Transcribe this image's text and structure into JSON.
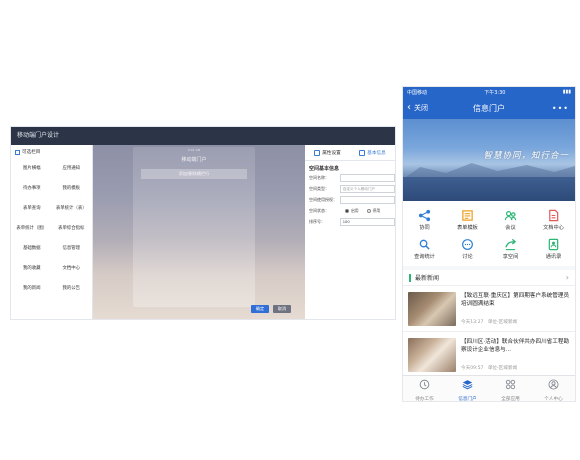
{
  "designer": {
    "title": "移动端门户设计",
    "left_panel": {
      "heading": "可选栏目",
      "items": [
        "图片横幅",
        "应用通知",
        "待办事项",
        "我的模板",
        "表单查询",
        "表单统计（表）",
        "表单统计（图）",
        "表单综合指标",
        "基础数据",
        "信息管理",
        "我的收藏",
        "文档中心",
        "我的新闻",
        "我的公告"
      ]
    },
    "canvas": {
      "phone_status": "9:41 AM",
      "phone_title": "移动端门户",
      "add_row_label": "添加/删除横栏行",
      "ok_label": "确定",
      "cancel_label": "取消"
    },
    "right_panel": {
      "tab_properties": "属性设置",
      "tab_basic": "基本信息",
      "section_title": "空间基本信息",
      "form": {
        "name_label": "空间名称：",
        "type_label": "空间类型：",
        "type_value": "自定义个人移动门户",
        "desc_label": "空间使用授权：",
        "status_label": "空间状态：",
        "status_enabled": "启用",
        "status_disabled": "停用",
        "sort_label": "排序号：",
        "sort_value": "100"
      }
    }
  },
  "phone": {
    "status": {
      "carrier": "中国移动",
      "time": "下午3:30"
    },
    "navbar": {
      "back_label": "关闭",
      "title": "信息门户"
    },
    "banner_slogan": "智慧协同，知行合一",
    "apps": [
      {
        "label": "协同",
        "icon": "share-icon",
        "color": "#2f7fd8"
      },
      {
        "label": "表单模板",
        "icon": "form-template-icon",
        "color": "#f0a32c"
      },
      {
        "label": "会议",
        "icon": "meeting-icon",
        "color": "#2bb673"
      },
      {
        "label": "文档中心",
        "icon": "document-icon",
        "color": "#e05a5a"
      },
      {
        "label": "查询统计",
        "icon": "query-icon",
        "color": "#2f7fd8"
      },
      {
        "label": "讨论",
        "icon": "discussion-icon",
        "color": "#2f7fd8"
      },
      {
        "label": "享空间",
        "icon": "share-space-icon",
        "color": "#2bb673"
      },
      {
        "label": "通讯录",
        "icon": "contacts-icon",
        "color": "#2bb673"
      }
    ],
    "news_section": "最新新闻",
    "news": [
      {
        "title": "【致远互联·重庆区】第四期客户系统管理员培训圆满结束",
        "time": "今天13:27",
        "unit": "单位-区域新闻"
      },
      {
        "title": "【四川区·活动】联合伙伴共办四川省工程勘察设计企业信息与...",
        "time": "今天09:57",
        "unit": "单位-区域新闻"
      }
    ],
    "tabbar": [
      {
        "label": "待办工作",
        "icon": "todo-icon",
        "active": false
      },
      {
        "label": "信息门户",
        "icon": "portal-icon",
        "active": true
      },
      {
        "label": "全部应用",
        "icon": "apps-icon",
        "active": false
      },
      {
        "label": "个人中心",
        "icon": "user-icon",
        "active": false
      }
    ],
    "accent_color": "#2766c9"
  }
}
